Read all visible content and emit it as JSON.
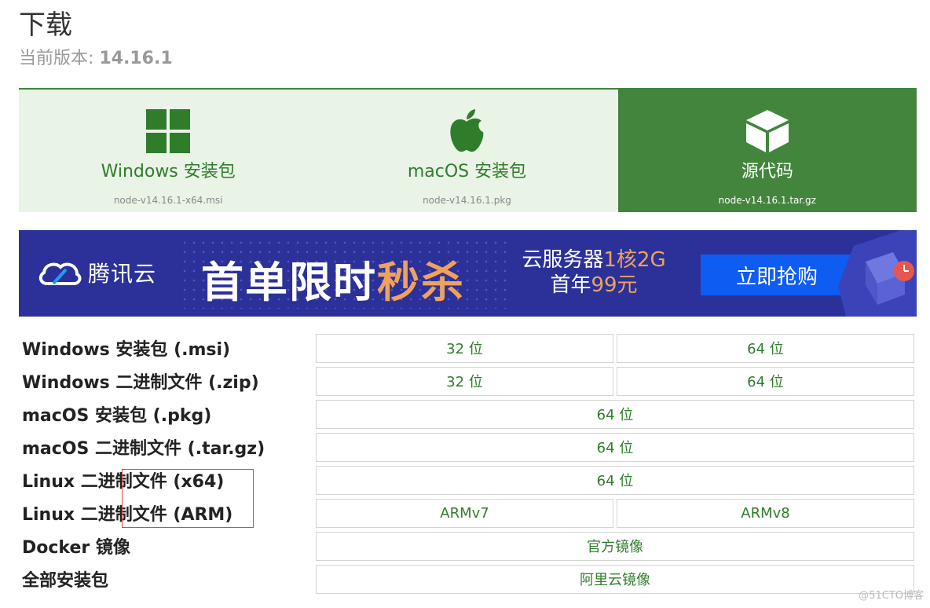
{
  "header": {
    "title": "下载",
    "version_label": "当前版本: ",
    "version": "14.16.1"
  },
  "tiles": [
    {
      "label": "Windows 安装包",
      "file": "node-v14.16.1-x64.msi",
      "icon": "windows-icon"
    },
    {
      "label": "macOS 安装包",
      "file": "node-v14.16.1.pkg",
      "icon": "apple-icon"
    },
    {
      "label": "源代码",
      "file": "node-v14.16.1.tar.gz",
      "icon": "box-icon",
      "active": true
    }
  ],
  "banner": {
    "brand": "腾讯云",
    "headline_a": "首单限时",
    "headline_b": "秒杀",
    "promo_line1_a": "云服务器",
    "promo_line1_b": "1核2G",
    "promo_line2_a": "首年",
    "promo_line2_b": "99元",
    "cta": "立即抢购",
    "accent": "#f0a25a",
    "bg": "#2b3199"
  },
  "rows": [
    {
      "label": "Windows 安装包 (.msi)",
      "cells": [
        "32 位",
        "64 位"
      ]
    },
    {
      "label": "Windows 二进制文件 (.zip)",
      "cells": [
        "32 位",
        "64 位"
      ]
    },
    {
      "label": "macOS 安装包 (.pkg)",
      "cells": [
        "64 位"
      ]
    },
    {
      "label": "macOS 二进制文件 (.tar.gz)",
      "cells": [
        "64 位"
      ]
    },
    {
      "label": "Linux 二进制文件 (x64)",
      "cells": [
        "64 位"
      ]
    },
    {
      "label": "Linux 二进制文件 (ARM)",
      "cells": [
        "ARMv7",
        "ARMv8"
      ]
    },
    {
      "label": "Docker 镜像",
      "cells": [
        "官方镜像"
      ]
    },
    {
      "label": "全部安装包",
      "cells": [
        "阿里云镜像"
      ]
    }
  ],
  "watermark": "@51CTO博客",
  "colors": {
    "brand_green": "#43853d",
    "link_green": "#2f7d2b",
    "tile_bg": "#e9f3e6"
  }
}
